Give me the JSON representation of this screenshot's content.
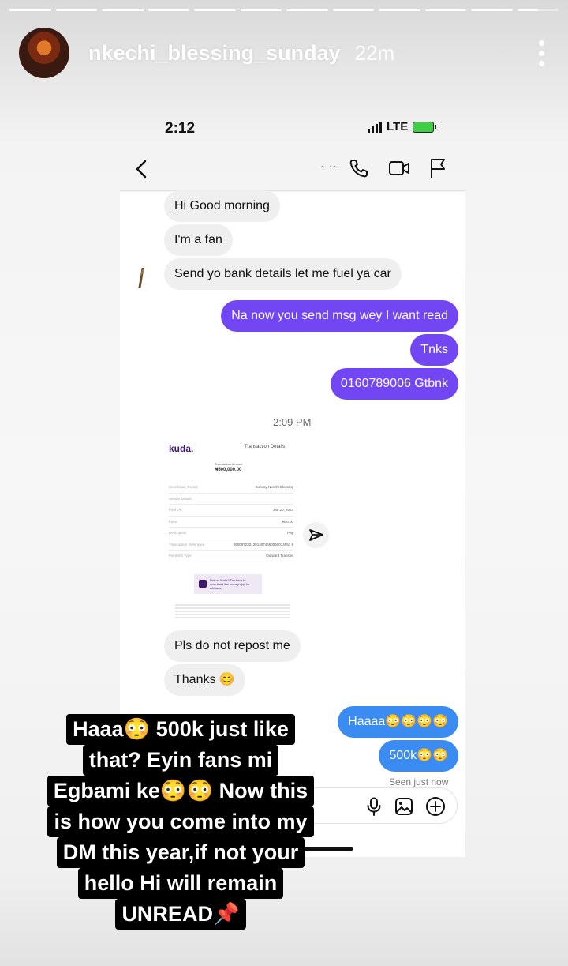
{
  "story": {
    "progress": {
      "segments": 12,
      "current": 12,
      "current_fill": 0.5
    },
    "username": "nkechi_blessing_sunday",
    "time_ago": "22m",
    "more_icon": "more-vertical-icon"
  },
  "phone_status": {
    "time": "2:12",
    "network": "LTE",
    "signal_icon": "signal-icon",
    "battery_icon": "battery-charging-icon"
  },
  "dm_header": {
    "back_icon": "chevron-left-icon",
    "name_glyph": "· ··",
    "call_icon": "phone-icon",
    "video_icon": "video-icon",
    "flag_icon": "flag-icon"
  },
  "messages": {
    "m1": "Hi Good morning",
    "m2": "I'm a fan",
    "m3": "Send yo bank details let me fuel ya car",
    "m4": "Na now you send msg wey I want read",
    "m5": "Tnks",
    "m6": "0160789006 Gtbnk",
    "timestamp": "2:09 PM",
    "m7": "Pls do not repost me",
    "m8": "Thanks 😊",
    "m9": "Haaaa😳😳😳😳",
    "m10": "500k😳😳",
    "seen": "Seen just now"
  },
  "receipt": {
    "logo": "kuda.",
    "title": "Transaction Details",
    "amount_label": "Transaction Amount",
    "amount": "₦500,000.00",
    "rows": [
      {
        "label": "Beneficiary Details",
        "value": "Sunday Nkechi Blessing"
      },
      {
        "label": "Sender Details",
        "value": ""
      },
      {
        "label": "Paid On",
        "value": "Jan 20, 2023"
      },
      {
        "label": "Fees",
        "value": "₦10.00"
      },
      {
        "label": "Description",
        "value": "Pay"
      },
      {
        "label": "Transaction Reference",
        "value": "09008723013014074660060074951 9"
      },
      {
        "label": "Payment Type",
        "value": "Outward Transfer"
      }
    ],
    "promo": "Not on Kuda? Tap here to download the money app for Africans",
    "share_icon": "send-icon"
  },
  "composer": {
    "mic_icon": "microphone-icon",
    "image_icon": "image-icon",
    "add_icon": "plus-circle-icon"
  },
  "caption": {
    "lines": [
      "Haaa😳 500k just like",
      "that? Eyin fans mi",
      "Egbami ke😳😳 Now this",
      "is how you come into my",
      "DM this year,if not your",
      "hello Hi will remain",
      "UNREAD📌"
    ]
  },
  "colors": {
    "outgoing_purple": "#7247f3",
    "outgoing_blue": "#3a8cf2",
    "incoming_gray": "#efefef",
    "kuda_brand": "#40196d"
  }
}
